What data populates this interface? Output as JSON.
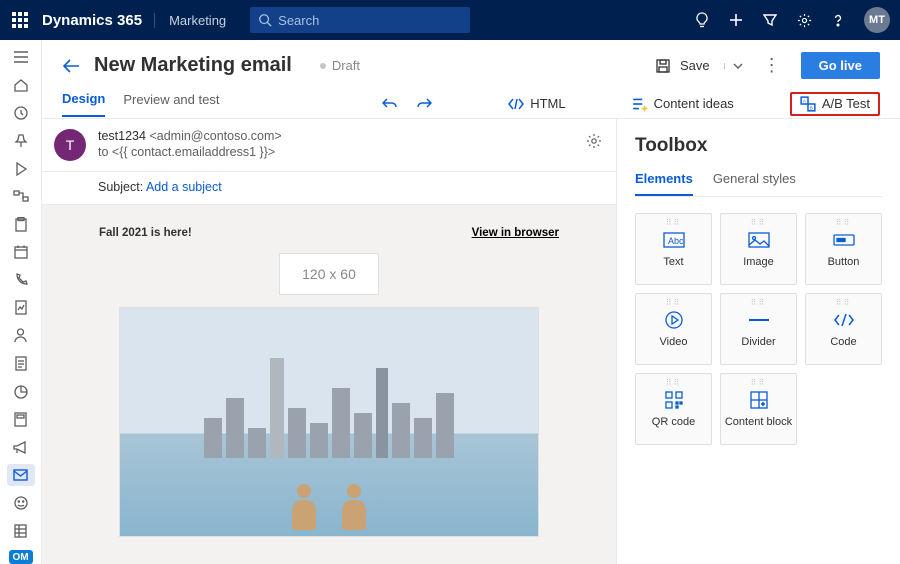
{
  "topbar": {
    "brand": "Dynamics 365",
    "app": "Marketing",
    "search_placeholder": "Search",
    "avatar": "MT"
  },
  "leftrail": {
    "items": [
      "menu",
      "home",
      "clock",
      "pin",
      "play",
      "workflow",
      "clipboard",
      "calendar",
      "phone",
      "report",
      "person",
      "form",
      "chart",
      "template",
      "megaphone",
      "mail",
      "smile",
      "sheet"
    ],
    "badge": "OM"
  },
  "header": {
    "title": "New Marketing email",
    "status": "Draft",
    "save": "Save",
    "golive": "Go live"
  },
  "tabs": {
    "design": "Design",
    "preview": "Preview and test",
    "html": "HTML",
    "ideas": "Content ideas",
    "abtest": "A/B Test"
  },
  "envelope": {
    "avatar": "T",
    "from_name": "test1234",
    "from_email": "<admin@contoso.com>",
    "to_line": "to  <{{ contact.emailaddress1 }}>",
    "subject_label": "Subject:",
    "subject_link": "Add a subject"
  },
  "email": {
    "preheader": "Fall 2021 is here!",
    "view_in_browser": "View in browser",
    "logo_placeholder": "120 x 60"
  },
  "toolbox": {
    "title": "Toolbox",
    "tabs": {
      "elements": "Elements",
      "styles": "General styles"
    },
    "tiles": {
      "text": "Text",
      "image": "Image",
      "button": "Button",
      "video": "Video",
      "divider": "Divider",
      "code": "Code",
      "qr": "QR code",
      "block": "Content block"
    }
  }
}
